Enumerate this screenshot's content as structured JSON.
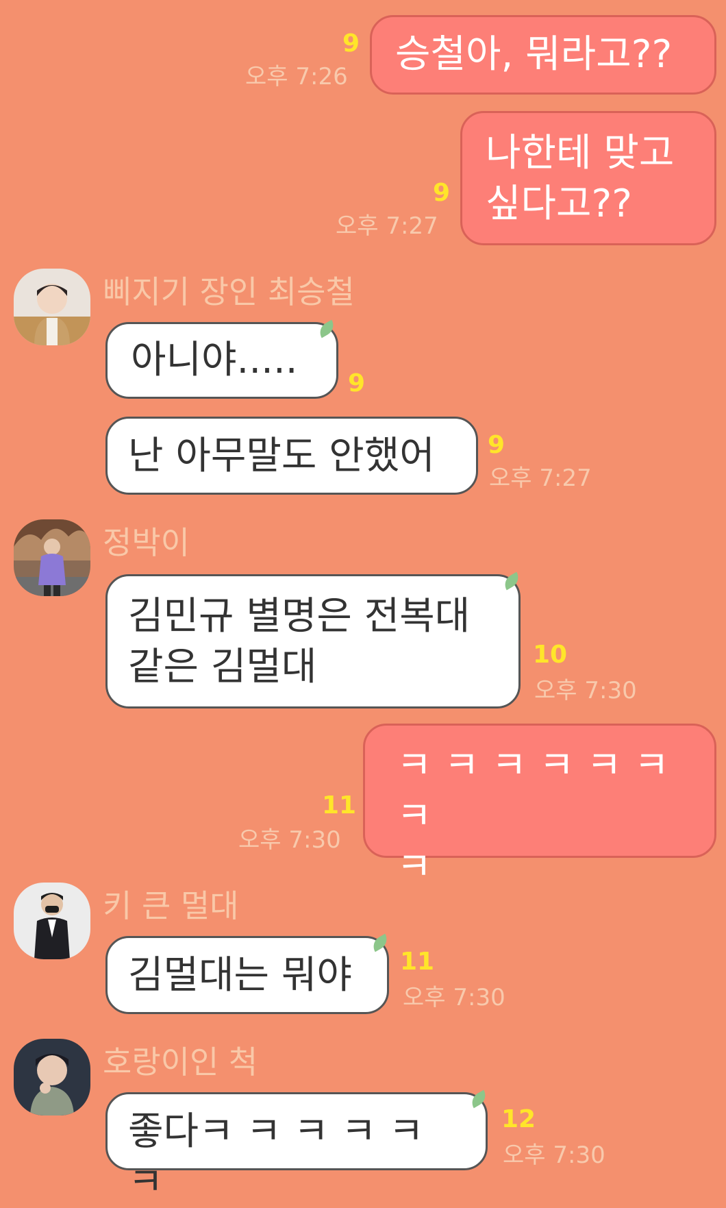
{
  "messages": [
    {
      "text": "승철아, 뭐라고??",
      "count": "9",
      "time": "오후 7:26"
    },
    {
      "text": "나한테 맞고\n싶다고??",
      "count": "9",
      "time": "오후 7:27"
    },
    {
      "sender": "삐지기 장인 최승철",
      "text": "아니야.....",
      "count": "9"
    },
    {
      "text": "난 아무말도 안했어",
      "count": "9",
      "time": "오후 7:27"
    },
    {
      "sender": "정박이",
      "text": "김민규 별명은 전복대\n같은 김멀대",
      "count": "10",
      "time": "오후 7:30"
    },
    {
      "text": "ㅋ ㅋ ㅋ ㅋ ㅋ ㅋ ㅋ\nㅋ",
      "count": "11",
      "time": "오후 7:30"
    },
    {
      "sender": "키 큰 멀대",
      "text": "김멀대는 뭐야",
      "count": "11",
      "time": "오후 7:30"
    },
    {
      "sender": "호랑이인 척",
      "text": "좋다ㅋ ㅋ ㅋ ㅋ ㅋ ㅋ",
      "count": "12",
      "time": "오후 7:30"
    }
  ],
  "colors": {
    "background": "#f4906e",
    "my_bubble": "#fd7f77",
    "their_bubble": "#ffffff",
    "unread_count": "#ffe52a",
    "timestamp": "#f8c9ac",
    "sender_name": "#f9c8a8"
  }
}
